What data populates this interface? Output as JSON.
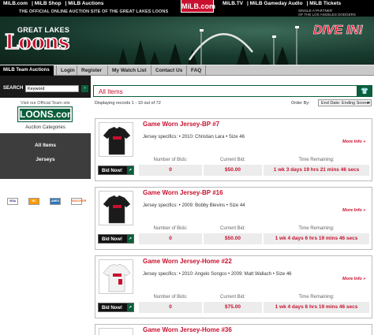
{
  "topbar": {
    "left_links": [
      "MiLB.com",
      "MiLB Shop",
      "MiLB Auctions"
    ],
    "logo": "MiLB.com",
    "right_links": [
      "MiLB.TV",
      "MiLB Gameday Audio",
      "MiLB Tickets"
    ]
  },
  "subbar": {
    "tagline": "THE OFFICIAL ONLINE AUCTION SITE OF THE GREAT LAKES LOONS",
    "affiliate_line1": "SINGLE-A PARTNER",
    "affiliate_line2": "OF THE LOS ANGELES DODGERS"
  },
  "banner": {
    "team_top": "GREAT LAKES",
    "team_main": "Loons",
    "slogan": "DIVE IN!"
  },
  "nav": {
    "team_auctions": "MiLB Team Auctions",
    "team_sub": "SELECT A TEAM",
    "items": [
      "Login",
      "Register",
      "My Watch List",
      "Contact Us",
      "FAQ"
    ]
  },
  "sidebar": {
    "search_label": "SEARCH",
    "search_value": "Keyword",
    "visit_text": "Visit our Official Team site",
    "site_logo": "LOONS.com",
    "categories_title": "Auction Categories",
    "categories": [
      "All Items",
      "Jerseys"
    ],
    "cards": [
      "VISA",
      "MC",
      "AMEX",
      "DISCOVER"
    ]
  },
  "main": {
    "heading": "All Items",
    "displaying": "Displaying records 1 - 10 out of 72",
    "order_by_label": "Order By:",
    "order_by_value": "End Date: Ending Sooner",
    "col_bids": "Number of Bids:",
    "col_current": "Current Bid:",
    "col_time": "Time Remaining:",
    "bid_label": "Bid Now!",
    "more_label": "More Info",
    "items": [
      {
        "title": "Game Worn Jersey-BP #7",
        "spec": "Jersey specifics: • 2010: Christian Lara • Size 46",
        "bids": "0",
        "current": "$50.00",
        "time": "1 wk 3 days 19 hrs 21 mins 46 secs",
        "jersey_color": "#1b1b1b"
      },
      {
        "title": "Game Worn Jersey-BP #16",
        "spec": "Jersey specifics: • 2009: Bobby Blevins • Size 44",
        "bids": "0",
        "current": "$50.00",
        "time": "1 wk 4 days 6 hrs 19 mins 46 secs",
        "jersey_color": "#1b1b1b"
      },
      {
        "title": "Game Worn Jersey-Home #22",
        "spec": "Jersey specifics: • 2010: Angelo Songco • 2009: Matt Wallach • Size 46",
        "bids": "0",
        "current": "$75.00",
        "time": "1 wk 4 days 6 hrs 19 mins 46 secs",
        "jersey_color": "#f2f2f2"
      },
      {
        "title": "Game Worn Jersey-Home #36"
      }
    ]
  },
  "colors": {
    "red": "#c8102e",
    "green": "#0b5e3b",
    "black": "#000000"
  }
}
